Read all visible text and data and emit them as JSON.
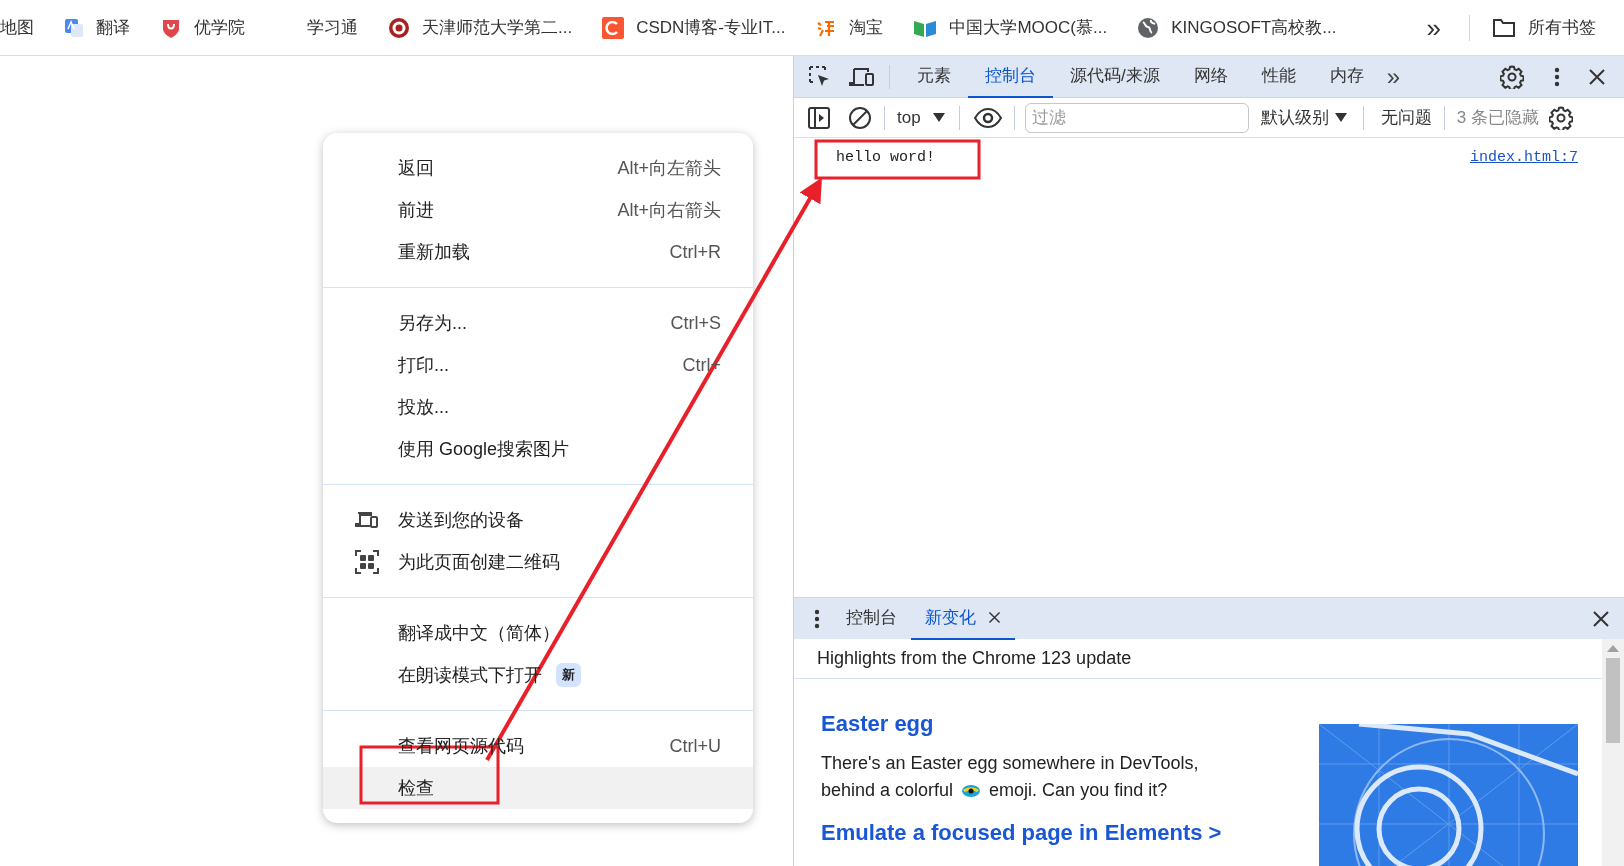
{
  "bookmarks": [
    {
      "label": "地图",
      "kind": "none"
    },
    {
      "label": "翻译",
      "kind": "translate"
    },
    {
      "label": "优学院",
      "kind": "shield"
    },
    {
      "label": "学习通",
      "kind": "blank"
    },
    {
      "label": "天津师范大学第二...",
      "kind": "seal"
    },
    {
      "label": "CSDN博客-专业IT...",
      "kind": "csdn"
    },
    {
      "label": "淘宝",
      "kind": "taobao"
    },
    {
      "label": "中国大学MOOC(慕...",
      "kind": "book"
    },
    {
      "label": "KINGOSOFT高校教...",
      "kind": "globe"
    }
  ],
  "bookmarks_more": "»",
  "all_bookmarks": "所有书签",
  "context_menu": {
    "sections": [
      [
        {
          "label": "返回",
          "shortcut": "Alt+向左箭头",
          "kind": "plain",
          "highlighted": false
        },
        {
          "label": "前进",
          "shortcut": "Alt+向右箭头",
          "kind": "plain",
          "highlighted": false
        },
        {
          "label": "重新加载",
          "shortcut": "Ctrl+R",
          "kind": "plain",
          "highlighted": false
        }
      ],
      [
        {
          "label": "另存为...",
          "shortcut": "Ctrl+S",
          "kind": "plain",
          "highlighted": false
        },
        {
          "label": "打印...",
          "shortcut": "Ctrl+",
          "kind": "plain",
          "highlighted": false
        },
        {
          "label": "投放...",
          "kind": "plain",
          "highlighted": false
        },
        {
          "label": "使用 Google搜索图片",
          "kind": "plain",
          "highlighted": false
        }
      ],
      [
        {
          "label": "发送到您的设备",
          "kind": "devices",
          "highlighted": false
        },
        {
          "label": "为此页面创建二维码",
          "kind": "qr",
          "highlighted": false
        }
      ],
      [
        {
          "label": "翻译成中文（简体）",
          "kind": "plain",
          "highlighted": false
        },
        {
          "label": "在朗读模式下打开",
          "badge": "新",
          "kind": "plain",
          "highlighted": false
        }
      ],
      [
        {
          "label": "查看网页源代码",
          "shortcut": "Ctrl+U",
          "kind": "plain",
          "highlighted": false
        },
        {
          "label": "检查",
          "kind": "plain",
          "highlighted": true
        }
      ]
    ]
  },
  "devtools": {
    "tabs": [
      {
        "label": "元素",
        "selected": false
      },
      {
        "label": "控制台",
        "selected": true
      },
      {
        "label": "源代码/来源",
        "selected": false
      },
      {
        "label": "网络",
        "selected": false
      },
      {
        "label": "性能",
        "selected": false
      },
      {
        "label": "内存",
        "selected": false
      }
    ],
    "tabs_more": "»",
    "toolbar": {
      "context": "top",
      "filter_placeholder": "过滤",
      "level": "默认级别",
      "issues": "无问题",
      "hidden": "3 条已隐藏"
    },
    "messages": [
      {
        "text": "hello word!",
        "source": "index.html:7"
      }
    ],
    "drawer": {
      "tabs": [
        {
          "label": "控制台",
          "selected": false,
          "closable": false
        },
        {
          "label": "新变化",
          "selected": true,
          "closable": true
        }
      ],
      "header": "Highlights from the Chrome 123 update",
      "sections": [
        {
          "title": "Easter egg",
          "body_line": "There's an Easter egg somewhere in DevTools,",
          "body_before": "behind a colorful",
          "body_after": "emoji. Can you find it?"
        },
        {
          "title": "Emulate a focused page in Elements >"
        }
      ]
    }
  }
}
